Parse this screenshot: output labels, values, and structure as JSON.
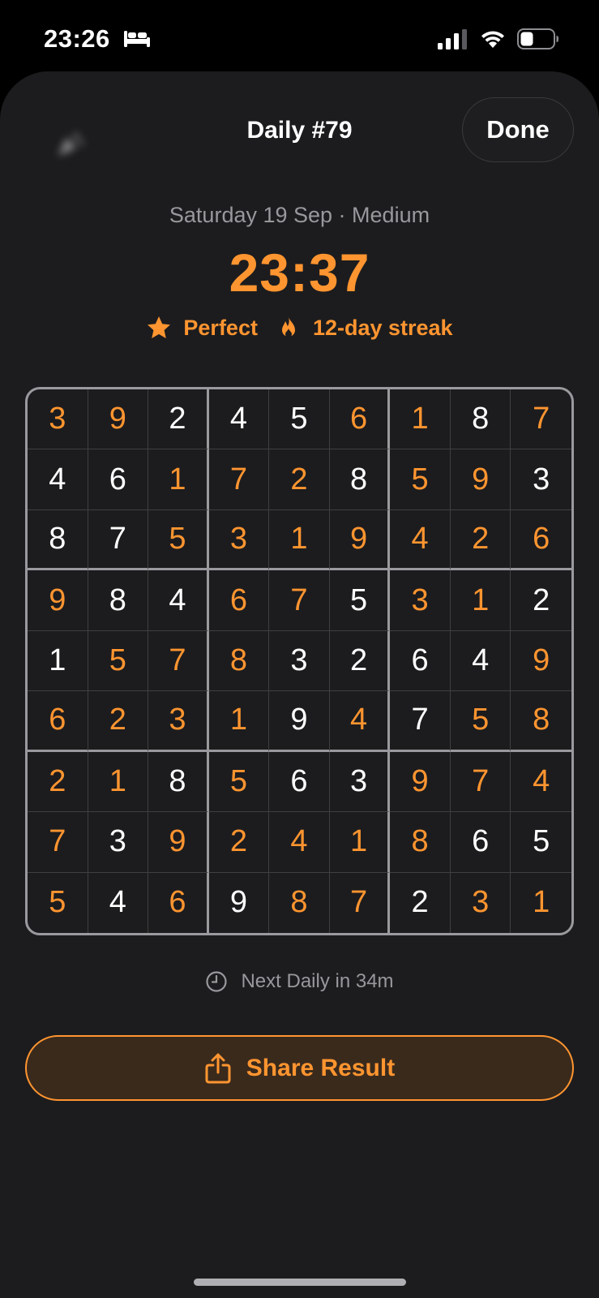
{
  "status_bar": {
    "time": "23:26"
  },
  "header": {
    "title": "Daily #79",
    "done_label": "Done"
  },
  "summary": {
    "subtitle": "Saturday 19 Sep · Medium",
    "time": "23:37",
    "badges": [
      {
        "icon": "star-icon",
        "label": "Perfect"
      },
      {
        "icon": "flame-icon",
        "label": "12-day streak"
      }
    ]
  },
  "grid": {
    "rows": [
      [
        "3",
        "9",
        "2",
        "4",
        "5",
        "6",
        "1",
        "8",
        "7"
      ],
      [
        "4",
        "6",
        "1",
        "7",
        "2",
        "8",
        "5",
        "9",
        "3"
      ],
      [
        "8",
        "7",
        "5",
        "3",
        "1",
        "9",
        "4",
        "2",
        "6"
      ],
      [
        "9",
        "8",
        "4",
        "6",
        "7",
        "5",
        "3",
        "1",
        "2"
      ],
      [
        "1",
        "5",
        "7",
        "8",
        "3",
        "2",
        "6",
        "4",
        "9"
      ],
      [
        "6",
        "2",
        "3",
        "1",
        "9",
        "4",
        "7",
        "5",
        "8"
      ],
      [
        "2",
        "1",
        "8",
        "5",
        "6",
        "3",
        "9",
        "7",
        "4"
      ],
      [
        "7",
        "3",
        "9",
        "2",
        "4",
        "1",
        "8",
        "6",
        "5"
      ],
      [
        "5",
        "4",
        "6",
        "9",
        "8",
        "7",
        "2",
        "3",
        "1"
      ]
    ],
    "orange_mask": [
      [
        1,
        1,
        0,
        0,
        0,
        1,
        1,
        0,
        1
      ],
      [
        0,
        0,
        1,
        1,
        1,
        0,
        1,
        1,
        0
      ],
      [
        0,
        0,
        1,
        1,
        1,
        1,
        1,
        1,
        1
      ],
      [
        1,
        0,
        0,
        1,
        1,
        0,
        1,
        1,
        0
      ],
      [
        0,
        1,
        1,
        1,
        0,
        0,
        0,
        0,
        1
      ],
      [
        1,
        1,
        1,
        1,
        0,
        1,
        0,
        1,
        1
      ],
      [
        1,
        1,
        0,
        1,
        0,
        0,
        1,
        1,
        1
      ],
      [
        1,
        0,
        1,
        1,
        1,
        1,
        1,
        0,
        0
      ],
      [
        1,
        0,
        1,
        0,
        1,
        1,
        0,
        1,
        1
      ]
    ]
  },
  "next_daily": {
    "label": "Next Daily in 34m"
  },
  "share": {
    "label": "Share Result"
  },
  "colors": {
    "accent": "#ff9530",
    "background": "#1c1c1e",
    "muted": "#98989d"
  }
}
